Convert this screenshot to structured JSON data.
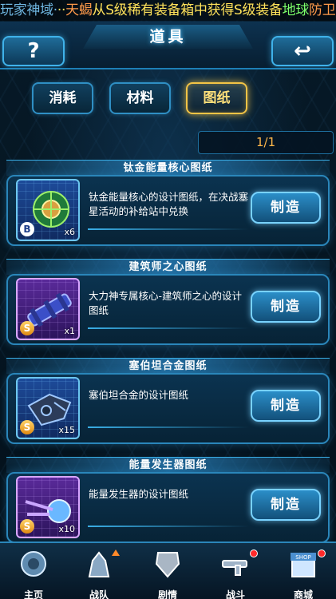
{
  "marquee": {
    "parts": [
      "玩家神域·",
      "··",
      "天蝎",
      "从S级稀有装备箱中获得S级装备",
      "地球",
      "防卫者"
    ]
  },
  "header": {
    "title": "道具",
    "help_label": "?",
    "back_label": "↩"
  },
  "tabs": [
    {
      "label": "消耗",
      "active": false
    },
    {
      "label": "材料",
      "active": false
    },
    {
      "label": "图纸",
      "active": true
    }
  ],
  "pager": {
    "text": "1/1"
  },
  "items": [
    {
      "name": "钛金能量核心图纸",
      "desc": "钛金能量核心的设计图纸，在决战塞星活动的补给站中兑换",
      "grade": "B",
      "qty": "x6",
      "button": "制造",
      "icon": "energy-core-icon"
    },
    {
      "name": "建筑师之心图纸",
      "desc": "大力神专属核心-建筑师之心的设计图纸",
      "grade": "S",
      "qty": "x1",
      "button": "制造",
      "icon": "architect-heart-icon"
    },
    {
      "name": "塞伯坦合金图纸",
      "desc": "塞伯坦合金的设计图纸",
      "grade": "S",
      "qty": "x15",
      "button": "制造",
      "icon": "cybertron-alloy-icon"
    },
    {
      "name": "能量发生器图纸",
      "desc": "能量发生器的设计图纸",
      "grade": "S",
      "qty": "x10",
      "button": "制造",
      "icon": "energy-generator-icon"
    }
  ],
  "nav": [
    {
      "label": "主页",
      "icon": "home-icon",
      "badge": ""
    },
    {
      "label": "战队",
      "icon": "team-icon",
      "badge": "up"
    },
    {
      "label": "剧情",
      "icon": "story-icon",
      "badge": ""
    },
    {
      "label": "战斗",
      "icon": "battle-icon",
      "badge": "dot"
    },
    {
      "label": "商城",
      "icon": "shop-icon",
      "badge": "dot",
      "shop_text": "SHOP"
    }
  ],
  "colors": {
    "accent": "#3aaee6",
    "active_tab": "#f3c446",
    "pager_text": "#ffb74a",
    "badge": "#ff2a2a"
  }
}
